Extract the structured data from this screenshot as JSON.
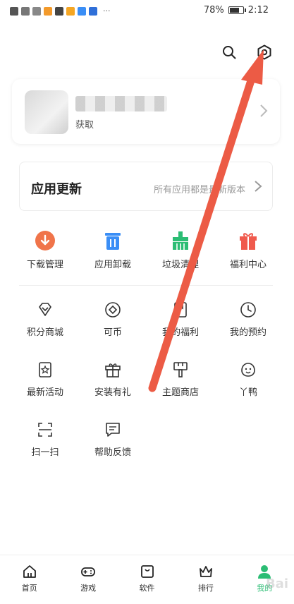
{
  "status_bar": {
    "battery": "78%",
    "battery_level": 0.78,
    "time": "2:12",
    "dots": "···"
  },
  "profile": {
    "subtitle": "获取",
    "chevron_icon": "chevron-right-icon"
  },
  "update": {
    "title": "应用更新",
    "status": "所有应用都是最新版本"
  },
  "tools": [
    {
      "label": "下载管理",
      "icon": "download-icon",
      "color": "#f0744a"
    },
    {
      "label": "应用卸载",
      "icon": "trash-icon",
      "color": "#3a8ef6"
    },
    {
      "label": "垃圾清理",
      "icon": "broom-icon",
      "color": "#2bbd74"
    },
    {
      "label": "福利中心",
      "icon": "gift-icon",
      "color": "#f05a4d"
    }
  ],
  "grid": [
    {
      "label": "积分商城",
      "icon": "diamond-icon"
    },
    {
      "label": "可币",
      "icon": "coin-icon"
    },
    {
      "label": "我的福利",
      "icon": "bookmark-icon"
    },
    {
      "label": "我的预约",
      "icon": "clock-icon"
    },
    {
      "label": "最新活动",
      "icon": "star-flag-icon"
    },
    {
      "label": "安装有礼",
      "icon": "gift-outline-icon"
    },
    {
      "label": "主题商店",
      "icon": "brush-icon"
    },
    {
      "label": "丫鸭",
      "icon": "duck-icon"
    },
    {
      "label": "扫一扫",
      "icon": "scan-icon"
    },
    {
      "label": "帮助反馈",
      "icon": "feedback-icon"
    }
  ],
  "nav": [
    {
      "label": "首页",
      "icon": "home-icon",
      "active": false
    },
    {
      "label": "游戏",
      "icon": "gamepad-icon",
      "active": false
    },
    {
      "label": "软件",
      "icon": "app-box-icon",
      "active": false
    },
    {
      "label": "排行",
      "icon": "crown-icon",
      "active": false
    },
    {
      "label": "我的",
      "icon": "profile-icon",
      "active": true
    }
  ],
  "colors": {
    "accent": "#2bbd74",
    "arrow": "#ec5b45"
  },
  "watermark": "Bai"
}
